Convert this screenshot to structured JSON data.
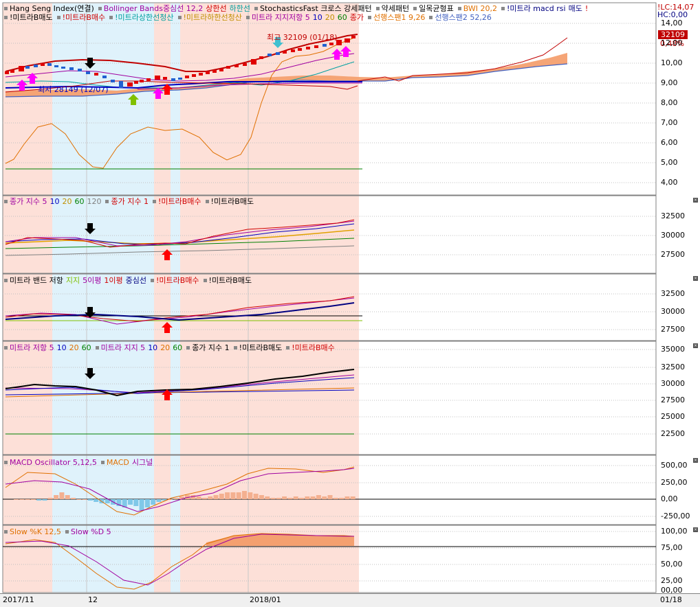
{
  "legends": {
    "p1_line1": [
      {
        "text": "Hang Seng Index(연결)",
        "color": "#000000"
      },
      {
        "text": "Bollinger Bands중심선 12,2",
        "color": "#a000a0"
      },
      {
        "text": "상한선",
        "color": "#d00000"
      },
      {
        "text": "하한선",
        "color": "#00a0a0"
      },
      {
        "text": "StochasticsFast 크로스 강세패턴",
        "color": "#000000"
      },
      {
        "text": "약세패턴",
        "color": "#000000"
      },
      {
        "text": "일목균형표",
        "color": "#000000"
      },
      {
        "text": "BWI 20,2",
        "color": "#e07000"
      },
      {
        "text": "!미트라 macd rsi",
        "color": "#000080"
      },
      {
        "text": "매도",
        "color": "#000080"
      },
      {
        "text": "!",
        "color": "#d00000"
      }
    ],
    "p1_line2": [
      {
        "text": "!미트라B매도",
        "color": "#000000"
      },
      {
        "text": "!미트라B매수",
        "color": "#d00000"
      },
      {
        "text": "!미트라상한선청산",
        "color": "#00a0a0"
      },
      {
        "text": "!미트라하한선청산",
        "color": "#c09000"
      },
      {
        "text": "미트라 지지저항 5",
        "color": "#a000a0"
      },
      {
        "text": "10",
        "color": "#0000c0"
      },
      {
        "text": "20",
        "color": "#c09000"
      },
      {
        "text": "60",
        "color": "#008000"
      },
      {
        "text": "종가",
        "color": "#d00000"
      },
      {
        "text": "선행스팬1 9,26",
        "color": "#e07000"
      },
      {
        "text": "선행스팬2 52,26",
        "color": "#4060c0"
      }
    ],
    "p2": [
      {
        "text": "종가 지수 5",
        "color": "#a000a0"
      },
      {
        "text": "10",
        "color": "#0000c0"
      },
      {
        "text": "20",
        "color": "#c09000"
      },
      {
        "text": "60",
        "color": "#008000"
      },
      {
        "text": "120",
        "color": "#808080"
      },
      {
        "text": "종가 지수 1",
        "color": "#d00000"
      },
      {
        "text": "!미트라B매수",
        "color": "#d00000"
      },
      {
        "text": "!미트라B매도",
        "color": "#000000"
      }
    ],
    "p3": [
      {
        "text": "미트라 밴드 저항",
        "color": "#000000"
      },
      {
        "text": "지지",
        "color": "#80c000"
      },
      {
        "text": "5이평",
        "color": "#a000a0"
      },
      {
        "text": "1이평",
        "color": "#d00000"
      },
      {
        "text": "중심선",
        "color": "#000080"
      },
      {
        "text": "!미트라B매수",
        "color": "#d00000"
      },
      {
        "text": "!미트라B매도",
        "color": "#000000"
      }
    ],
    "p4": [
      {
        "text": "미트라 저항 5",
        "color": "#a000a0"
      },
      {
        "text": "10",
        "color": "#0000c0"
      },
      {
        "text": "20",
        "color": "#e07000"
      },
      {
        "text": "60",
        "color": "#008000"
      },
      {
        "text": "미트라 지지 5",
        "color": "#a000a0"
      },
      {
        "text": "10",
        "color": "#0000c0"
      },
      {
        "text": "20",
        "color": "#e07000"
      },
      {
        "text": "60",
        "color": "#008000"
      },
      {
        "text": "종가 지수 1",
        "color": "#000000"
      },
      {
        "text": "!미트라B매도",
        "color": "#000000"
      },
      {
        "text": "!미트라B매수",
        "color": "#d00000"
      }
    ],
    "p5": [
      {
        "text": "MACD Oscillator 5,12,5",
        "color": "#a000a0"
      },
      {
        "text": "MACD",
        "color": "#e07000"
      },
      {
        "text": "시그널",
        "color": "#a000a0"
      }
    ],
    "p6": [
      {
        "text": "Slow %K 12,5",
        "color": "#e07000"
      },
      {
        "text": "Slow %D 5",
        "color": "#a000a0"
      }
    ]
  },
  "axes": {
    "p1": [
      "14,00",
      "12,00",
      "10,00",
      "9,00",
      "8,00",
      "7,00",
      "6,00",
      "5,00",
      "4,00"
    ],
    "p2": [
      "32500",
      "30000",
      "27500"
    ],
    "p3": [
      "32500",
      "30000",
      "27500"
    ],
    "p4": [
      "35000",
      "32500",
      "30000",
      "27500",
      "25000",
      "22500"
    ],
    "p5": [
      "500,00",
      "250,00",
      "0,00",
      "-250,00"
    ],
    "p6": [
      "100,00",
      "75,00",
      "50,00",
      "25,00",
      "00,00"
    ]
  },
  "header_right": {
    "lc": "!LC:14,07",
    "hc": "HC:0,00",
    "price": "32109",
    "pct": "0,48%"
  },
  "annotations": {
    "high": "최고 32109 (01/18)",
    "low": "최저 28149 (12/07)"
  },
  "x_axis": {
    "labels": [
      "2017/11",
      "12",
      "2018/01"
    ],
    "right": "01/18"
  },
  "colors": {
    "pink_zone": "#fde0d8",
    "blue_zone": "#dff2fb",
    "grid": "#c8c8c8",
    "upper_band": "#c00000",
    "cloud": "#f4a070"
  }
}
